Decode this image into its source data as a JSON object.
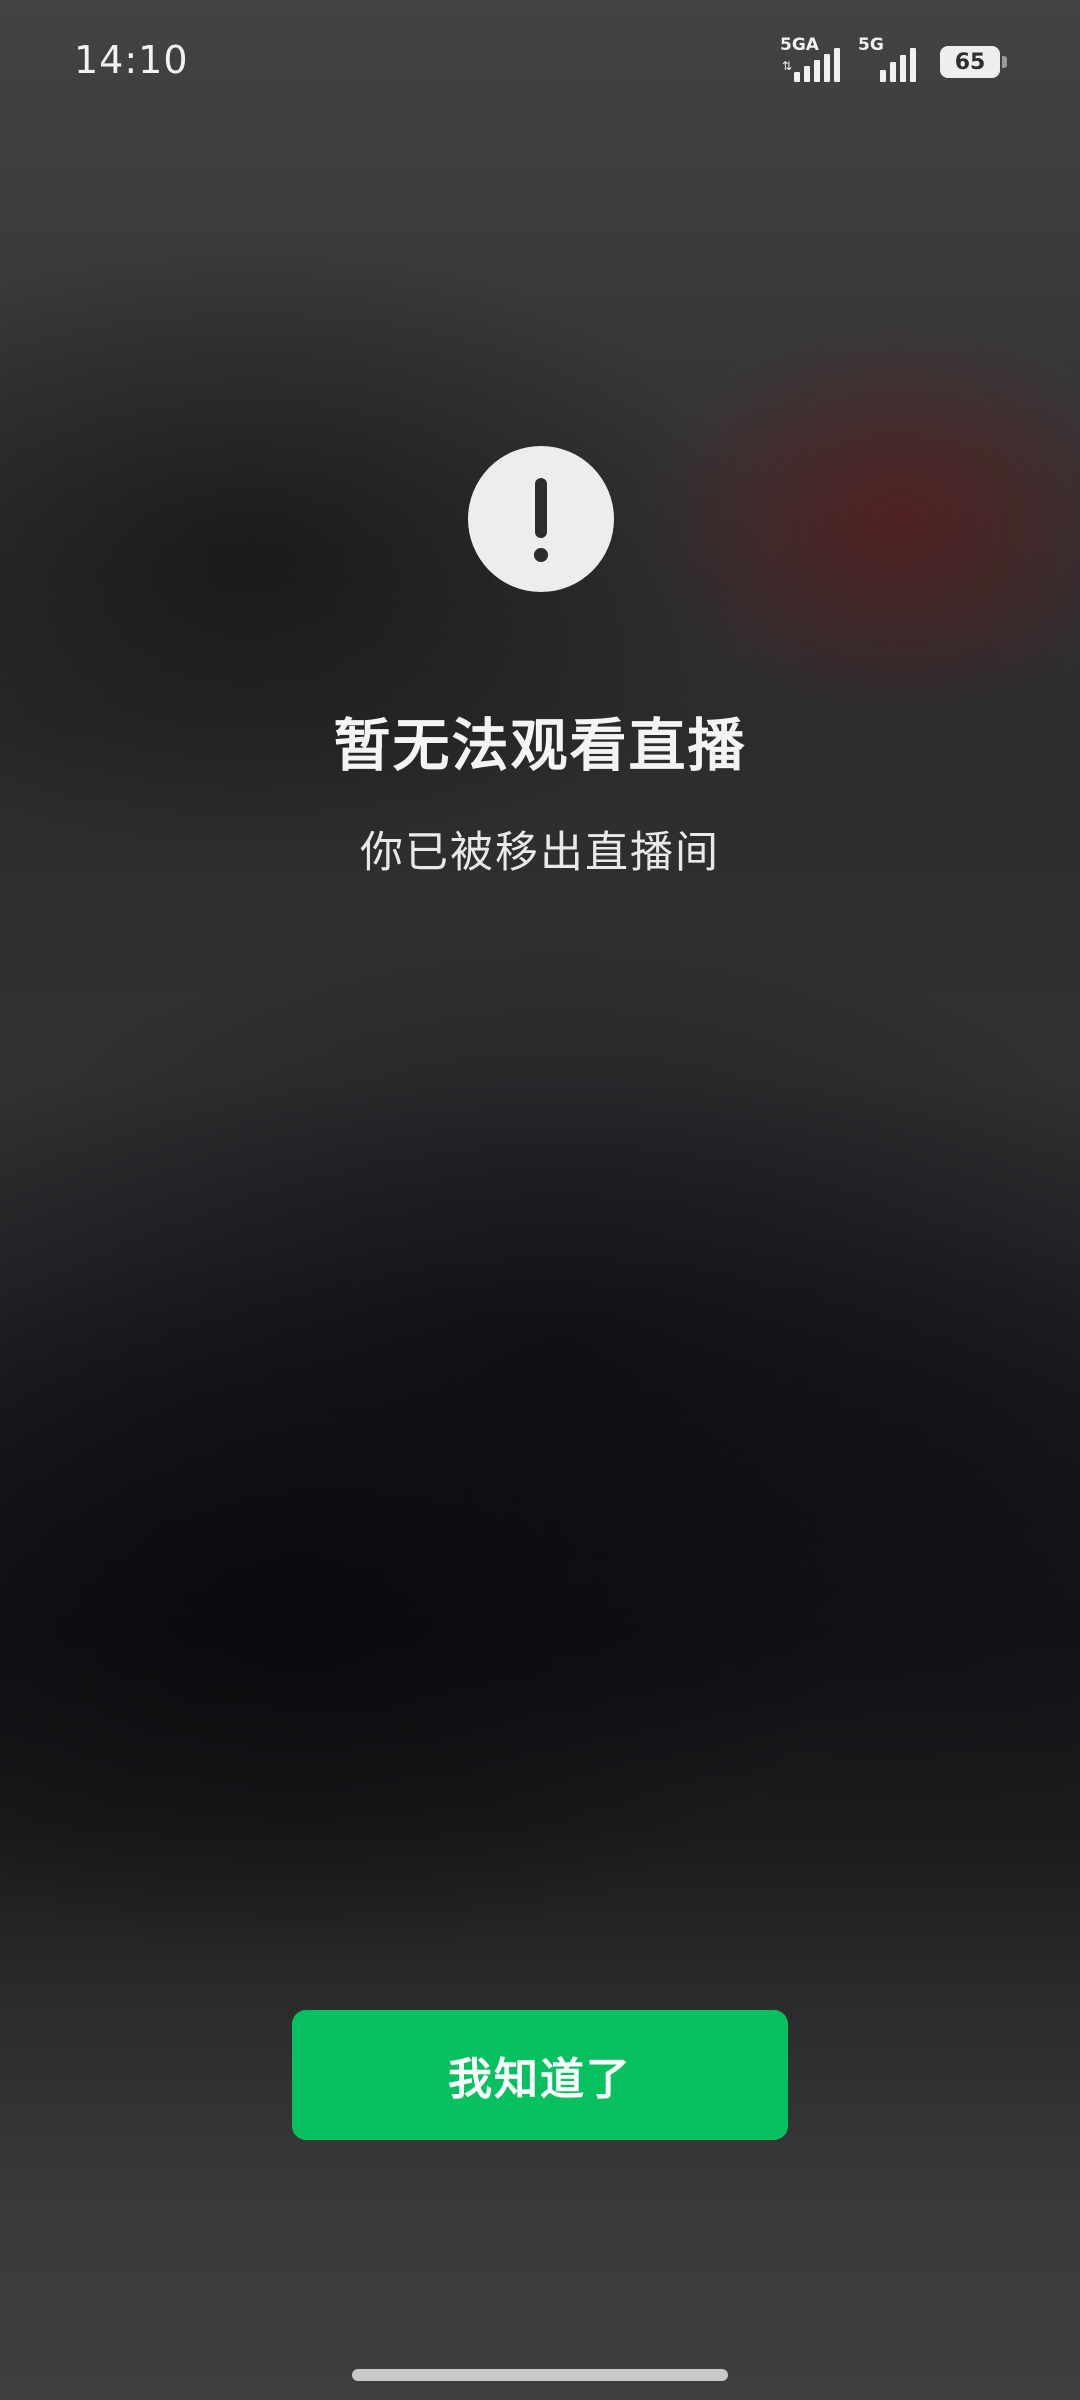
{
  "status_bar": {
    "time": "14:10",
    "network_1": "5GA",
    "network_1_arrows": "⇅",
    "network_2": "5G",
    "battery_level": "65",
    "icons": [
      "signal-icon",
      "signal-icon",
      "battery-icon"
    ]
  },
  "dialog": {
    "icon": "exclamation-icon",
    "title": "暂无法观看直播",
    "message": "你已被移出直播间",
    "confirm_label": "我知道了"
  },
  "colors": {
    "accent": "#07c160",
    "icon_background": "#ededed",
    "text": "#f4f4f4"
  }
}
